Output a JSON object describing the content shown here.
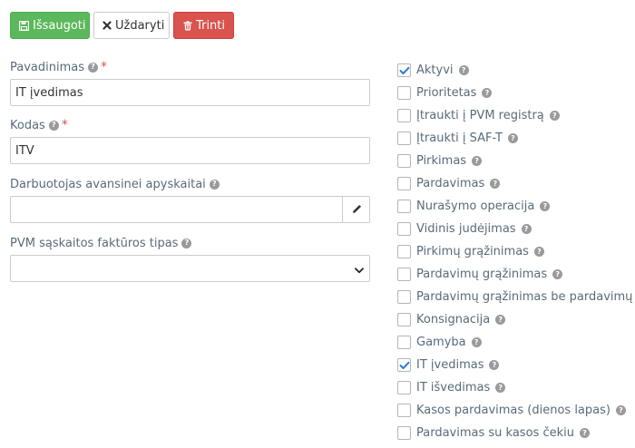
{
  "toolbar": {
    "save_label": "Išsaugoti",
    "close_label": "Uždaryti",
    "delete_label": "Trinti"
  },
  "fields": {
    "name": {
      "label": "Pavadinimas",
      "required_mark": "*",
      "value": "IT įvedimas"
    },
    "code": {
      "label": "Kodas",
      "required_mark": "*",
      "value": "ITV"
    },
    "employee": {
      "label": "Darbuotojas avansinei apyskaitai",
      "value": ""
    },
    "vat_invoice_type": {
      "label": "PVM sąskaitos faktūros tipas",
      "value": ""
    }
  },
  "checkboxes": [
    {
      "label": "Aktyvi",
      "checked": true
    },
    {
      "label": "Prioritetas",
      "checked": false
    },
    {
      "label": "Įtraukti į PVM registrą",
      "checked": false
    },
    {
      "label": "Įtraukti į SAF-T",
      "checked": false
    },
    {
      "label": "Pirkimas",
      "checked": false
    },
    {
      "label": "Pardavimas",
      "checked": false
    },
    {
      "label": "Nurašymo operacija",
      "checked": false
    },
    {
      "label": "Vidinis judėjimas",
      "checked": false
    },
    {
      "label": "Pirkimų grąžinimas",
      "checked": false
    },
    {
      "label": "Pardavimų grąžinimas",
      "checked": false
    },
    {
      "label": "Pardavimų grąžinimas be pardavimų",
      "checked": false
    },
    {
      "label": "Konsignacija",
      "checked": false
    },
    {
      "label": "Gamyba",
      "checked": false
    },
    {
      "label": "IT įvedimas",
      "checked": true
    },
    {
      "label": "IT išvedimas",
      "checked": false
    },
    {
      "label": "Kasos pardavimas (dienos lapas)",
      "checked": false
    },
    {
      "label": "Pardavimas su kasos čekiu",
      "checked": false
    }
  ],
  "colors": {
    "save": "#5cb85c",
    "delete": "#d9534f",
    "required": "#d9534f",
    "check": "#2b7bd6"
  }
}
